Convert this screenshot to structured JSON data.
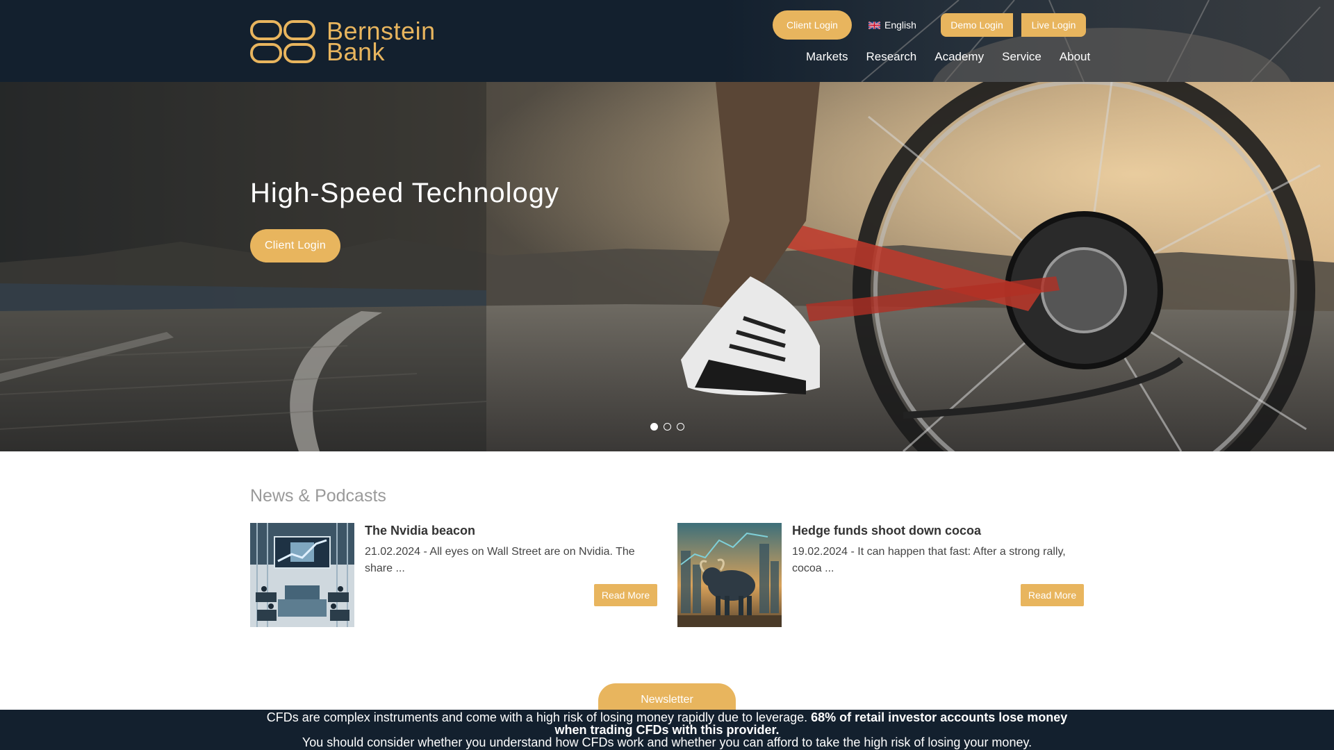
{
  "brand": {
    "name_line1": "Bernstein",
    "name_line2": "Bank"
  },
  "header": {
    "client_login": "Client Login",
    "language": "English",
    "demo_login": "Demo Login",
    "live_login": "Live Login",
    "nav": [
      "Markets",
      "Research",
      "Academy",
      "Service",
      "About"
    ]
  },
  "hero": {
    "title": "High-Speed Technology",
    "cta": "Client Login",
    "slides_total": 3,
    "active_slide": 1
  },
  "news": {
    "section_title": "News & Podcasts",
    "items": [
      {
        "headline": "The Nvidia beacon",
        "excerpt": "21.02.2024 - All eyes on Wall Street are on Nvidia. The share ...",
        "read_more": "Read More",
        "thumb_icon": "ai-trading-floor-image"
      },
      {
        "headline": "Hedge funds shoot down cocoa",
        "excerpt": "19.02.2024 -  It can happen that fast: After a strong rally, cocoa ...",
        "read_more": "Read More",
        "thumb_icon": "bull-city-image"
      }
    ]
  },
  "newsletter": {
    "label": "Newsletter"
  },
  "risk_warning": {
    "part1": "CFDs are complex instruments and come with a high risk of losing money rapidly due to leverage. ",
    "bold": "68% of retail investor accounts lose money when trading CFDs with this provider.",
    "part2": "You should consider whether you understand how CFDs work and whether you can afford to take the high risk of losing your money."
  },
  "colors": {
    "accent": "#e8b55e",
    "header_bg": "#13202e",
    "text": "#333333"
  }
}
